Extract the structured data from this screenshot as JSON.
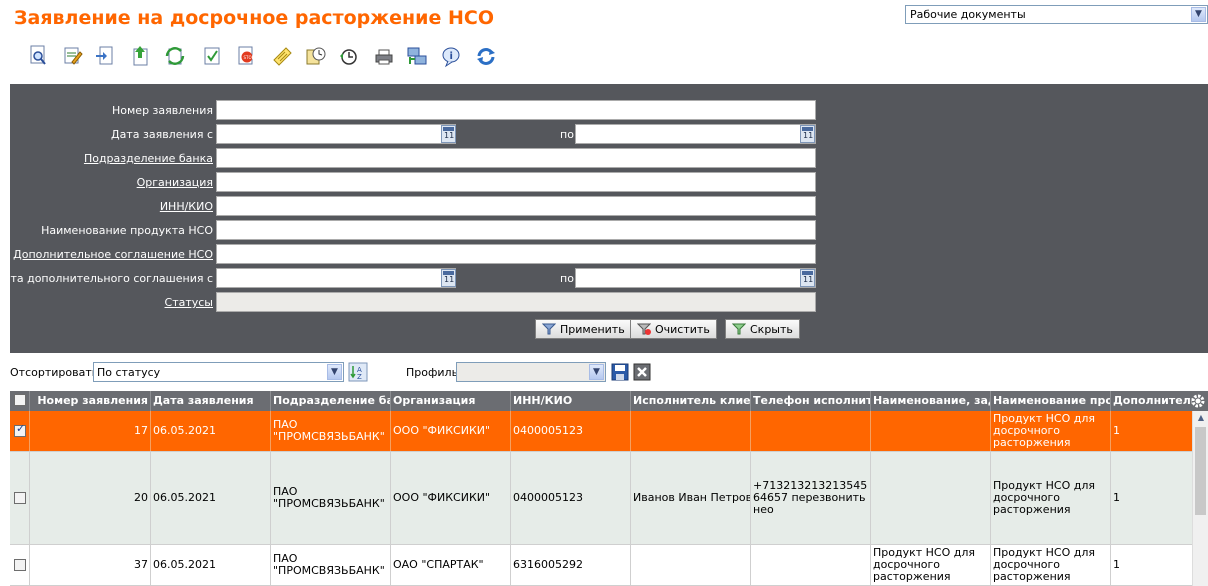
{
  "header": {
    "title": "Заявление на досрочное расторжение НСО",
    "doc_select_value": "Рабочие документы"
  },
  "toolbar": {
    "icons": [
      "view-icon",
      "edit-icon",
      "import-icon",
      "export-icon",
      "refresh-docs-icon",
      "sign-icon",
      "stop-icon",
      "note-icon",
      "schedule-icon",
      "history-icon",
      "print-icon",
      "network-icon",
      "info-icon",
      "sync-icon"
    ]
  },
  "filter": {
    "number_label": "Номер заявления",
    "date_from_label": "Дата заявления с",
    "date_to_label": "по",
    "bank_division_label": "Подразделение банка",
    "organization_label": "Организация",
    "inn_label": "ИНН/КИО",
    "product_label": "Наименование продукта НСО",
    "agreement_label": "Дополнительное соглашение НСО",
    "agreement_date_from_label": "Дата дополнительного соглашения с",
    "agreement_date_to_label": "по",
    "statuses_label": "Статусы",
    "apply_label": "Применить",
    "clear_label": "Очистить",
    "hide_label": "Скрыть"
  },
  "sorting": {
    "sort_label": "Отсортировать",
    "sort_value": "По статусу",
    "profile_label": "Профиль",
    "profile_value": ""
  },
  "grid": {
    "columns": [
      "Номер заявления",
      "Дата заявления",
      "Подразделение банка",
      "Организация",
      "ИНН/КИО",
      "Исполнитель клиента",
      "Телефон исполнителя",
      "Наименование, задача",
      "Наименование продукта",
      "Дополнительно"
    ],
    "rows": [
      {
        "checked": true,
        "number": "17",
        "date": "06.05.2021",
        "division": "ПАО \"ПРОМСВЯЗЬБАНК\"",
        "org": "ООО \"ФИКСИКИ\"",
        "inn": "0400005123",
        "executor": "",
        "phone": "",
        "task": "",
        "product": "Продукт НСО для досрочного расторжения",
        "extra": "1"
      },
      {
        "checked": false,
        "number": "20",
        "date": "06.05.2021",
        "division": "ПАО \"ПРОМСВЯЗЬБАНК\"",
        "org": "ООО \"ФИКСИКИ\"",
        "inn": "0400005123",
        "executor": "Иванов Иван Петрович",
        "phone": "+71321321321354564657 перезвонить нео",
        "task": "",
        "product": "Продукт НСО для досрочного расторжения",
        "extra": "1"
      },
      {
        "checked": false,
        "number": "37",
        "date": "06.05.2021",
        "division": "ПАО \"ПРОМСВЯЗЬБАНК\"",
        "org": "ОАО \"СПАРТАК\"",
        "inn": "6316005292",
        "executor": "",
        "phone": "",
        "task": "Продукт НСО для досрочного расторжения",
        "product": "Продукт НСО для досрочного расторжения",
        "extra": "1"
      }
    ]
  }
}
